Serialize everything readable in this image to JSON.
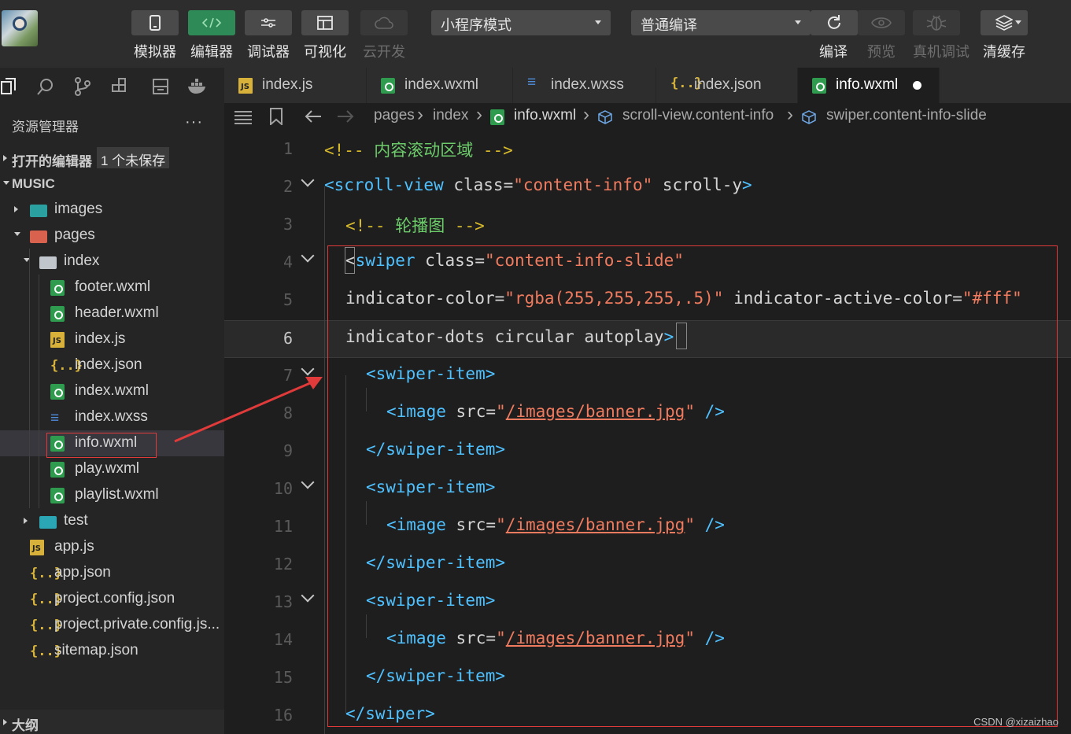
{
  "toolbar": {
    "tools": [
      {
        "label": "模拟器",
        "state": "normal",
        "icon": "phone-icon"
      },
      {
        "label": "编辑器",
        "state": "active",
        "icon": "code-icon"
      },
      {
        "label": "调试器",
        "state": "normal",
        "icon": "sliders-icon"
      },
      {
        "label": "可视化",
        "state": "normal",
        "icon": "layout-icon"
      },
      {
        "label": "云开发",
        "state": "disabled",
        "icon": "cloud-icon"
      }
    ],
    "mode_select": "小程序模式",
    "compile_select": "普通编译",
    "actions": [
      {
        "label": "编译",
        "state": "normal",
        "icon": "refresh-icon"
      },
      {
        "label": "预览",
        "state": "disabled",
        "icon": "eye-icon"
      },
      {
        "label": "真机调试",
        "state": "disabled",
        "icon": "bug-icon"
      },
      {
        "label": "清缓存",
        "state": "normal",
        "icon": "layers-icon"
      }
    ]
  },
  "explorer": {
    "title": "资源管理器",
    "more": "···",
    "open_editors": "打开的编辑器",
    "unsaved_badge": "1 个未保存",
    "project": "MUSIC",
    "tree": [
      {
        "name": "images",
        "type": "folder-img",
        "depth": 1,
        "expanded": false
      },
      {
        "name": "pages",
        "type": "folder-red",
        "depth": 1,
        "expanded": true
      },
      {
        "name": "index",
        "type": "folder-open",
        "depth": 2,
        "expanded": true
      },
      {
        "name": "footer.wxml",
        "type": "wxml",
        "depth": 3
      },
      {
        "name": "header.wxml",
        "type": "wxml",
        "depth": 3
      },
      {
        "name": "index.js",
        "type": "js",
        "depth": 3
      },
      {
        "name": "index.json",
        "type": "json",
        "depth": 3
      },
      {
        "name": "index.wxml",
        "type": "wxml",
        "depth": 3
      },
      {
        "name": "index.wxss",
        "type": "wxss",
        "depth": 3
      },
      {
        "name": "info.wxml",
        "type": "wxml",
        "depth": 3,
        "selected": true
      },
      {
        "name": "play.wxml",
        "type": "wxml",
        "depth": 3
      },
      {
        "name": "playlist.wxml",
        "type": "wxml",
        "depth": 3
      },
      {
        "name": "test",
        "type": "folder-test",
        "depth": 2,
        "expanded": false
      },
      {
        "name": "app.js",
        "type": "js",
        "depth": 1
      },
      {
        "name": "app.json",
        "type": "json",
        "depth": 1
      },
      {
        "name": "project.config.json",
        "type": "json",
        "depth": 1
      },
      {
        "name": "project.private.config.js...",
        "type": "json",
        "depth": 1
      },
      {
        "name": "sitemap.json",
        "type": "json",
        "depth": 1
      }
    ],
    "outline": "大纲"
  },
  "tabs": [
    {
      "name": "index.js",
      "type": "js"
    },
    {
      "name": "index.wxml",
      "type": "wxml"
    },
    {
      "name": "index.wxss",
      "type": "wxss"
    },
    {
      "name": "index.json",
      "type": "json"
    },
    {
      "name": "info.wxml",
      "type": "wxml",
      "active": true,
      "unsaved": true
    }
  ],
  "breadcrumb": [
    "pages",
    "index",
    "info.wxml",
    "scroll-view.content-info",
    "swiper.content-info-slide"
  ],
  "code_lines": [
    {
      "n": "1",
      "tokens": [
        [
          "cm",
          "<!-- "
        ],
        [
          "green",
          "内容滚动区域"
        ],
        [
          "cm",
          " -->"
        ]
      ],
      "indent": 0
    },
    {
      "n": "2",
      "fold": true,
      "tokens": [
        [
          "tag",
          "<scroll-view"
        ],
        [
          "attr",
          " class="
        ],
        [
          "str",
          "\"content-info\""
        ],
        [
          "attr",
          " scroll-y"
        ],
        [
          "tag",
          ">"
        ]
      ],
      "indent": 0
    },
    {
      "n": "3",
      "tokens": [
        [
          "cm",
          "<!-- "
        ],
        [
          "green",
          "轮播图"
        ],
        [
          "cm",
          " -->"
        ]
      ],
      "indent": 1
    },
    {
      "n": "4",
      "fold": true,
      "tokens": [
        [
          "punct",
          "<"
        ],
        [
          "tag",
          "swiper"
        ],
        [
          "attr",
          " class="
        ],
        [
          "str",
          "\"content-info-slide\""
        ]
      ],
      "indent": 1
    },
    {
      "n": "5",
      "tokens": [
        [
          "attr",
          "indicator-color="
        ],
        [
          "str",
          "\"rgba(255,255,255,.5)\""
        ],
        [
          "attr",
          " indicator-active-color="
        ],
        [
          "str",
          "\"#fff\""
        ]
      ],
      "indent": 1
    },
    {
      "n": "6",
      "current": true,
      "tokens": [
        [
          "attr",
          "indicator-dots circular autoplay"
        ],
        [
          "tag",
          ">"
        ]
      ],
      "indent": 1
    },
    {
      "n": "7",
      "fold": true,
      "tokens": [
        [
          "tag",
          "<swiper-item>"
        ]
      ],
      "indent": 2
    },
    {
      "n": "8",
      "tokens": [
        [
          "tag",
          "<image"
        ],
        [
          "attr",
          " src="
        ],
        [
          "str",
          "\""
        ],
        [
          "link",
          "/images/banner.jpg"
        ],
        [
          "str",
          "\""
        ],
        [
          "tag",
          " />"
        ]
      ],
      "indent": 3
    },
    {
      "n": "9",
      "tokens": [
        [
          "tag",
          "</swiper-item>"
        ]
      ],
      "indent": 2
    },
    {
      "n": "10",
      "fold": true,
      "tokens": [
        [
          "tag",
          "<swiper-item>"
        ]
      ],
      "indent": 2
    },
    {
      "n": "11",
      "tokens": [
        [
          "tag",
          "<image"
        ],
        [
          "attr",
          " src="
        ],
        [
          "str",
          "\""
        ],
        [
          "link",
          "/images/banner.jpg"
        ],
        [
          "str",
          "\""
        ],
        [
          "tag",
          " />"
        ]
      ],
      "indent": 3
    },
    {
      "n": "12",
      "tokens": [
        [
          "tag",
          "</swiper-item>"
        ]
      ],
      "indent": 2
    },
    {
      "n": "13",
      "fold": true,
      "tokens": [
        [
          "tag",
          "<swiper-item>"
        ]
      ],
      "indent": 2
    },
    {
      "n": "14",
      "tokens": [
        [
          "tag",
          "<image"
        ],
        [
          "attr",
          " src="
        ],
        [
          "str",
          "\""
        ],
        [
          "link",
          "/images/banner.jpg"
        ],
        [
          "str",
          "\""
        ],
        [
          "tag",
          " />"
        ]
      ],
      "indent": 3
    },
    {
      "n": "15",
      "tokens": [
        [
          "tag",
          "</swiper-item>"
        ]
      ],
      "indent": 2
    },
    {
      "n": "16",
      "tokens": [
        [
          "tag",
          "</swiper>"
        ]
      ],
      "indent": 1
    }
  ],
  "watermark": "CSDN @xizaizhao",
  "colors": {
    "annotation": "#e03a3a",
    "active_tool": "#2e8b57"
  }
}
